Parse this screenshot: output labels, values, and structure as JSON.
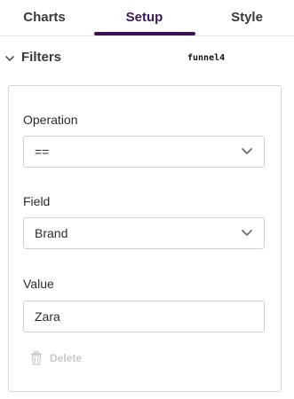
{
  "tabs": [
    {
      "label": "Charts"
    },
    {
      "label": "Setup"
    },
    {
      "label": "Style"
    }
  ],
  "active_tab": "Setup",
  "filters": {
    "title": "Filters",
    "chart_id": "funnel4",
    "operation": {
      "label": "Operation",
      "value": "=="
    },
    "field": {
      "label": "Field",
      "value": "Brand"
    },
    "value": {
      "label": "Value",
      "value": "Zara"
    },
    "delete_label": "Delete"
  },
  "colors": {
    "accent": "#3d1255",
    "border": "#d9d9d9",
    "disabled": "#c8c8c8"
  }
}
